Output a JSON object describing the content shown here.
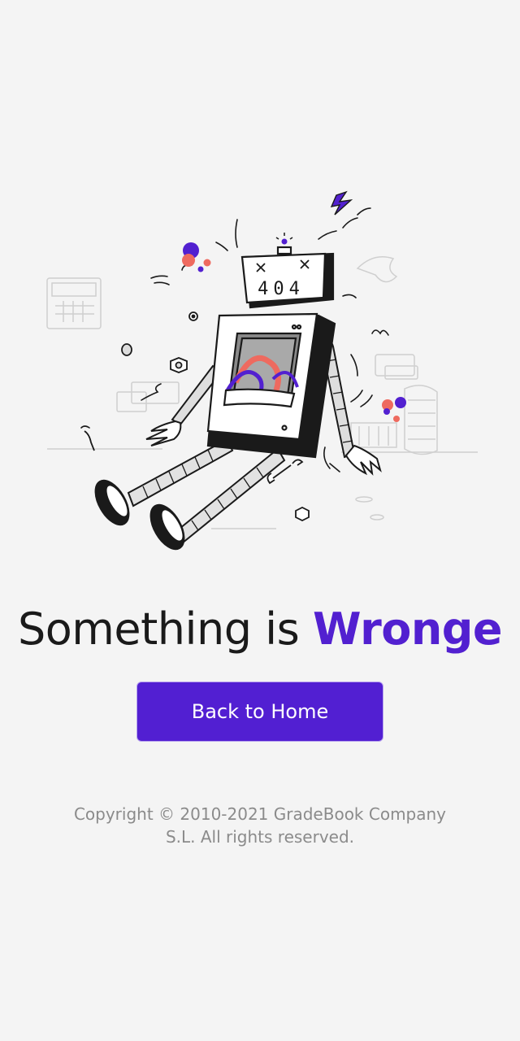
{
  "error": {
    "code_on_screen": "404",
    "headline_prefix": "Something is",
    "headline_accent": "Wronge"
  },
  "actions": {
    "home_button_label": "Back to Home"
  },
  "footer": {
    "copyright_line1": "Copyright © 2010-2021 GradeBook Company",
    "copyright_line2": "S.L. All rights reserved."
  },
  "illustration": {
    "subject": "broken-robot",
    "colors": {
      "accent_purple": "#5220d0",
      "accent_coral": "#ee6a5f",
      "outline": "#1a1a1a",
      "body_fill": "#ffffff",
      "metal_gray": "#d8d8d8"
    }
  },
  "theme": {
    "background": "#f4f4f4",
    "primary": "#521fd2",
    "text": "#1a1a1a",
    "muted_text": "#8b8b8b"
  }
}
